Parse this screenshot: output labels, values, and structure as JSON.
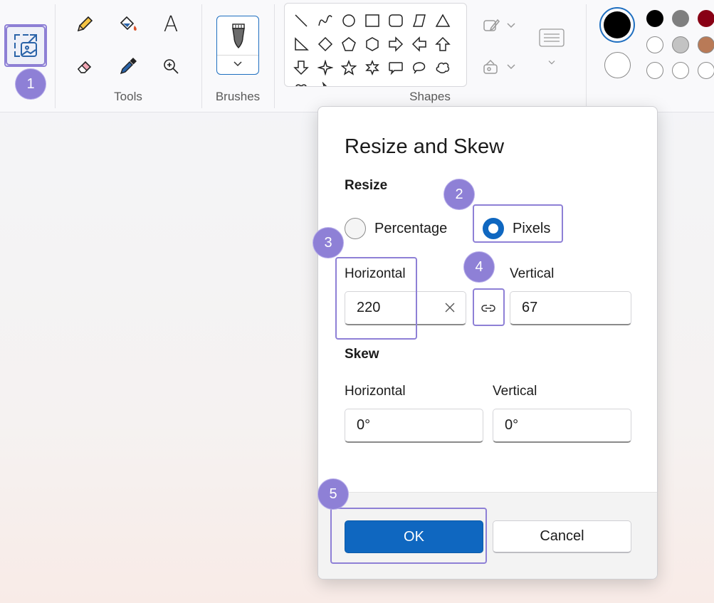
{
  "ribbon": {
    "groups": {
      "tools_label": "Tools",
      "brushes_label": "Brushes",
      "shapes_label": "Shapes"
    },
    "tools": [
      "pencil-icon",
      "fill-icon",
      "text-icon",
      "eraser-icon",
      "color-picker-icon",
      "magnifier-icon"
    ],
    "text_tool_glyph": "A",
    "shapes": [
      "line",
      "curve",
      "oval",
      "rectangle",
      "rounded-rectangle",
      "polygon",
      "triangle",
      "right-triangle",
      "diamond",
      "pentagon",
      "hexagon",
      "arrow-right",
      "arrow-left",
      "arrow-up",
      "arrow-down",
      "star-4",
      "star-5",
      "star-6",
      "callout-rect",
      "callout-oval",
      "callout-cloud"
    ],
    "colors": {
      "primary": "#000000",
      "secondary": "#ffffff",
      "palette": [
        "#000000",
        "#7f7f7f",
        "#880015",
        "#ffffff",
        "#c3c3c3",
        "#b97a57",
        "#ffffff",
        "#ffffff",
        "#ffffff"
      ]
    }
  },
  "badges": {
    "b1": "1",
    "b2": "2",
    "b3": "3",
    "b4": "4",
    "b5": "5"
  },
  "dialog": {
    "title": "Resize and Skew",
    "resize_label": "Resize",
    "percentage_label": "Percentage",
    "pixels_label": "Pixels",
    "selected_mode": "Pixels",
    "horizontal_label": "Horizontal",
    "vertical_label": "Vertical",
    "horizontal_value": "220",
    "vertical_value": "67",
    "skew_label": "Skew",
    "skew_horizontal_label": "Horizontal",
    "skew_vertical_label": "Vertical",
    "skew_horizontal_value": "0°",
    "skew_vertical_value": "0°",
    "ok_label": "OK",
    "cancel_label": "Cancel"
  },
  "accent_color": "#0f67c0",
  "highlight_color": "#8e80d6"
}
